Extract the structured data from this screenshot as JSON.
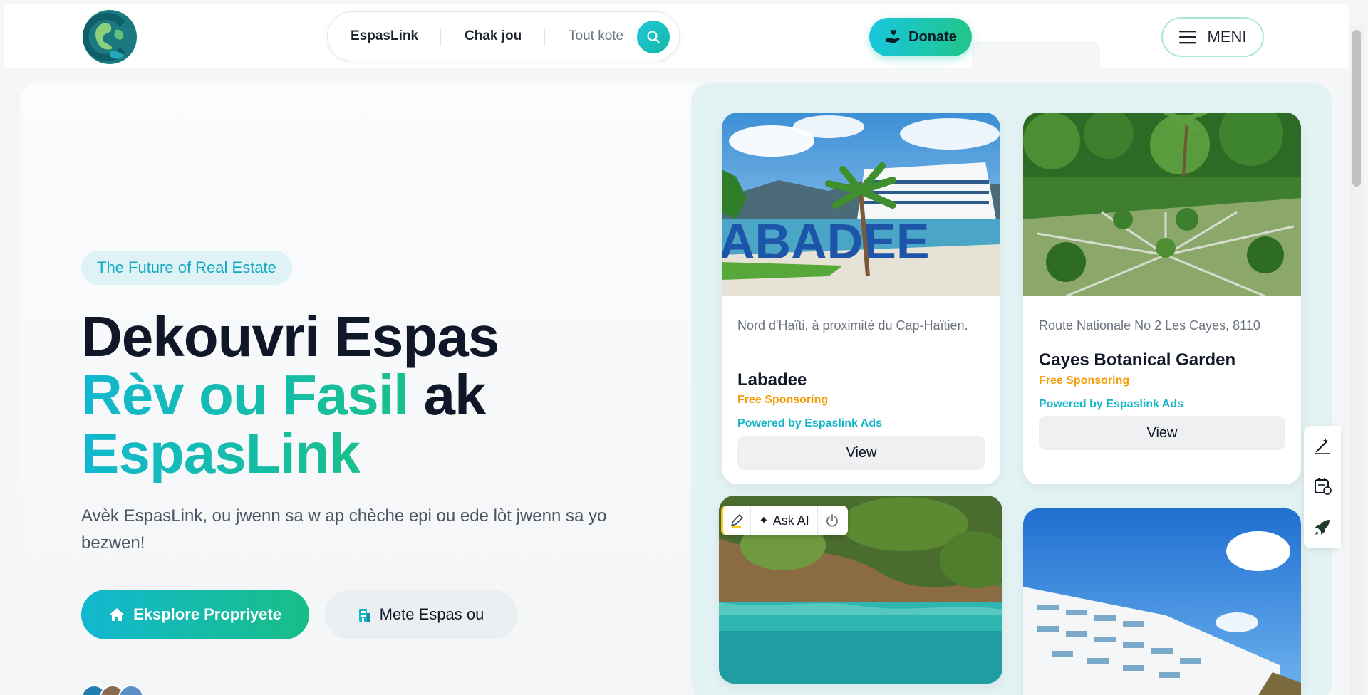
{
  "header": {
    "nav": {
      "item1": "EspasLink",
      "item2": "Chak jou",
      "where_placeholder": "Tout kote"
    },
    "donate_label": "Donate",
    "menu_label": "MENI"
  },
  "hero": {
    "tag": "The Future of Real Estate",
    "headline_line1": "Dekouvri Espas",
    "headline_grad1": "Rèv ou Fasil",
    "headline_plain": " ak",
    "headline_grad2": "EspasLink",
    "subtitle": "Avèk EspasLink, ou jwenn sa w ap chèche epi ou ede lòt jwenn sa yo bezwen!",
    "primary_button": "Eksplore Propriyete",
    "secondary_button": "Mete Espas ou"
  },
  "cards": [
    {
      "location": "Nord d'Haïti, à proximité du Cap-Haïtien.",
      "name": "Labadee",
      "sponsorship": "Free Sponsoring",
      "powered": "Powered by Espaslink Ads",
      "view_label": "View"
    },
    {
      "location": "Route Nationale No 2 Les Cayes, 8110",
      "name": "Cayes Botanical Garden",
      "sponsorship": "Free Sponsoring",
      "powered": "Powered by Espaslink Ads",
      "view_label": "View"
    }
  ],
  "ask_ai": {
    "label": "Ask AI"
  },
  "icons": {
    "logo": "globe-logo-icon",
    "search": "search-icon",
    "donate": "hand-heart-icon",
    "menu": "hamburger-icon",
    "home": "home-icon",
    "building": "building-icon",
    "pen": "pen-icon",
    "sparkle": "sparkle-icon",
    "power": "power-icon",
    "magic": "magic-wand-icon",
    "schedule": "calendar-edit-icon",
    "rocket": "rocket-icon"
  },
  "colors": {
    "accent_teal": "#12b8cf",
    "accent_green": "#19c08c",
    "sponsor_orange": "#f59e0b",
    "powered_teal": "#13b6c7"
  }
}
